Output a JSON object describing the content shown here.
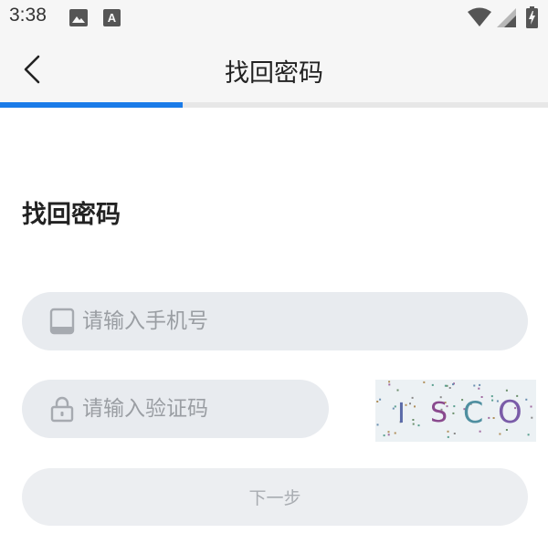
{
  "status_bar": {
    "time": "3:38",
    "icons": [
      "image-icon",
      "font-icon",
      "wifi-icon",
      "signal-icon",
      "battery-icon"
    ]
  },
  "header": {
    "title": "找回密码",
    "back_icon": "back-arrow-icon"
  },
  "progress": {
    "fraction": 0.333,
    "accent_color": "#1a7be8"
  },
  "main": {
    "heading": "找回密码",
    "phone_input": {
      "placeholder": "请输入手机号",
      "value": "",
      "icon": "tablet-icon"
    },
    "code_input": {
      "placeholder": "请输入验证码",
      "value": "",
      "icon": "lock-icon"
    },
    "captcha": {
      "chars": [
        "I",
        "S",
        "C",
        "O"
      ],
      "colors": [
        "#5a6aa8",
        "#8a4a8e",
        "#4f8fa0",
        "#7a5ca8"
      ]
    },
    "next_button": {
      "label": "下一步"
    }
  }
}
